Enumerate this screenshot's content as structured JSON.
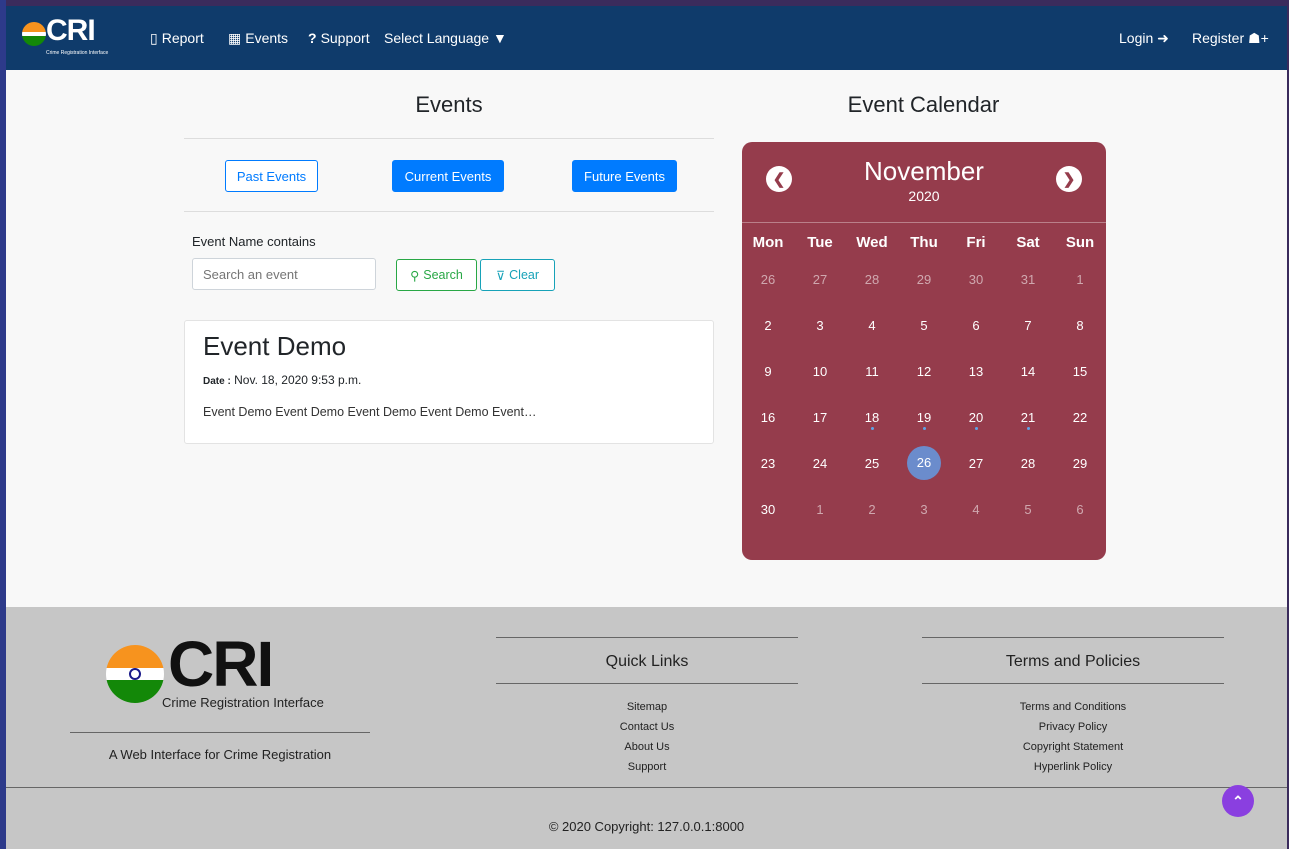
{
  "nav": {
    "brand": "CRI",
    "brand_sub": "Crime Registration Interface",
    "report": "Report",
    "events": "Events",
    "support": "Support",
    "language": "Select Language",
    "login": "Login",
    "register": "Register"
  },
  "events": {
    "heading": "Events",
    "past_label": "Past Events",
    "current_label": "Current Events",
    "future_label": "Future Events",
    "search_label": "Event Name contains",
    "search_placeholder": "Search an event",
    "search_button": "Search",
    "clear_button": "Clear",
    "card": {
      "title": "Event Demo",
      "date_label": "Date :",
      "date_value": "Nov. 18, 2020 9:53 p.m.",
      "text": "Event Demo Event Demo Event Demo Event Demo Event…"
    }
  },
  "calendar": {
    "heading": "Event Calendar",
    "month": "November",
    "year": "2020",
    "prev_icon": "chevron-left-icon",
    "next_icon": "chevron-right-icon",
    "weekdays": [
      "Mon",
      "Tue",
      "Wed",
      "Thu",
      "Fri",
      "Sat",
      "Sun"
    ],
    "weeks": [
      [
        {
          "d": "26",
          "m": true
        },
        {
          "d": "27",
          "m": true
        },
        {
          "d": "28",
          "m": true
        },
        {
          "d": "29",
          "m": true
        },
        {
          "d": "30",
          "m": true
        },
        {
          "d": "31",
          "m": true
        },
        {
          "d": "1",
          "m": true
        }
      ],
      [
        {
          "d": "2"
        },
        {
          "d": "3"
        },
        {
          "d": "4"
        },
        {
          "d": "5"
        },
        {
          "d": "6"
        },
        {
          "d": "7"
        },
        {
          "d": "8"
        }
      ],
      [
        {
          "d": "9"
        },
        {
          "d": "10"
        },
        {
          "d": "11"
        },
        {
          "d": "12"
        },
        {
          "d": "13"
        },
        {
          "d": "14"
        },
        {
          "d": "15"
        }
      ],
      [
        {
          "d": "16"
        },
        {
          "d": "17"
        },
        {
          "d": "18",
          "dot": true
        },
        {
          "d": "19",
          "dot": true
        },
        {
          "d": "20",
          "dot": true
        },
        {
          "d": "21",
          "dot": true
        },
        {
          "d": "22"
        }
      ],
      [
        {
          "d": "23"
        },
        {
          "d": "24"
        },
        {
          "d": "25"
        },
        {
          "d": "26",
          "today": true
        },
        {
          "d": "27"
        },
        {
          "d": "28"
        },
        {
          "d": "29"
        }
      ],
      [
        {
          "d": "30"
        },
        {
          "d": "1",
          "m": true
        },
        {
          "d": "2",
          "m": true
        },
        {
          "d": "3",
          "m": true
        },
        {
          "d": "4",
          "m": true
        },
        {
          "d": "5",
          "m": true
        },
        {
          "d": "6",
          "m": true
        }
      ]
    ],
    "accent": "#953c4c"
  },
  "footer": {
    "logo": "CRI",
    "logo_sub": "Crime Registration Interface",
    "tagline": "A Web Interface for Crime Registration",
    "quick_links_title": "Quick Links",
    "quick_links": [
      "Sitemap",
      "Contact Us",
      "About Us",
      "Support"
    ],
    "terms_title": "Terms and Policies",
    "terms_links": [
      "Terms and Conditions",
      "Privacy Policy",
      "Copyright Statement",
      "Hyperlink Policy"
    ],
    "copyright": "© 2020 Copyright:   127.0.0.1:8000"
  },
  "colors": {
    "navbar": "#0f3b6b",
    "primary": "#007bff",
    "footer": "#c6c6c6",
    "scroll_top": "#8a3fe0"
  }
}
